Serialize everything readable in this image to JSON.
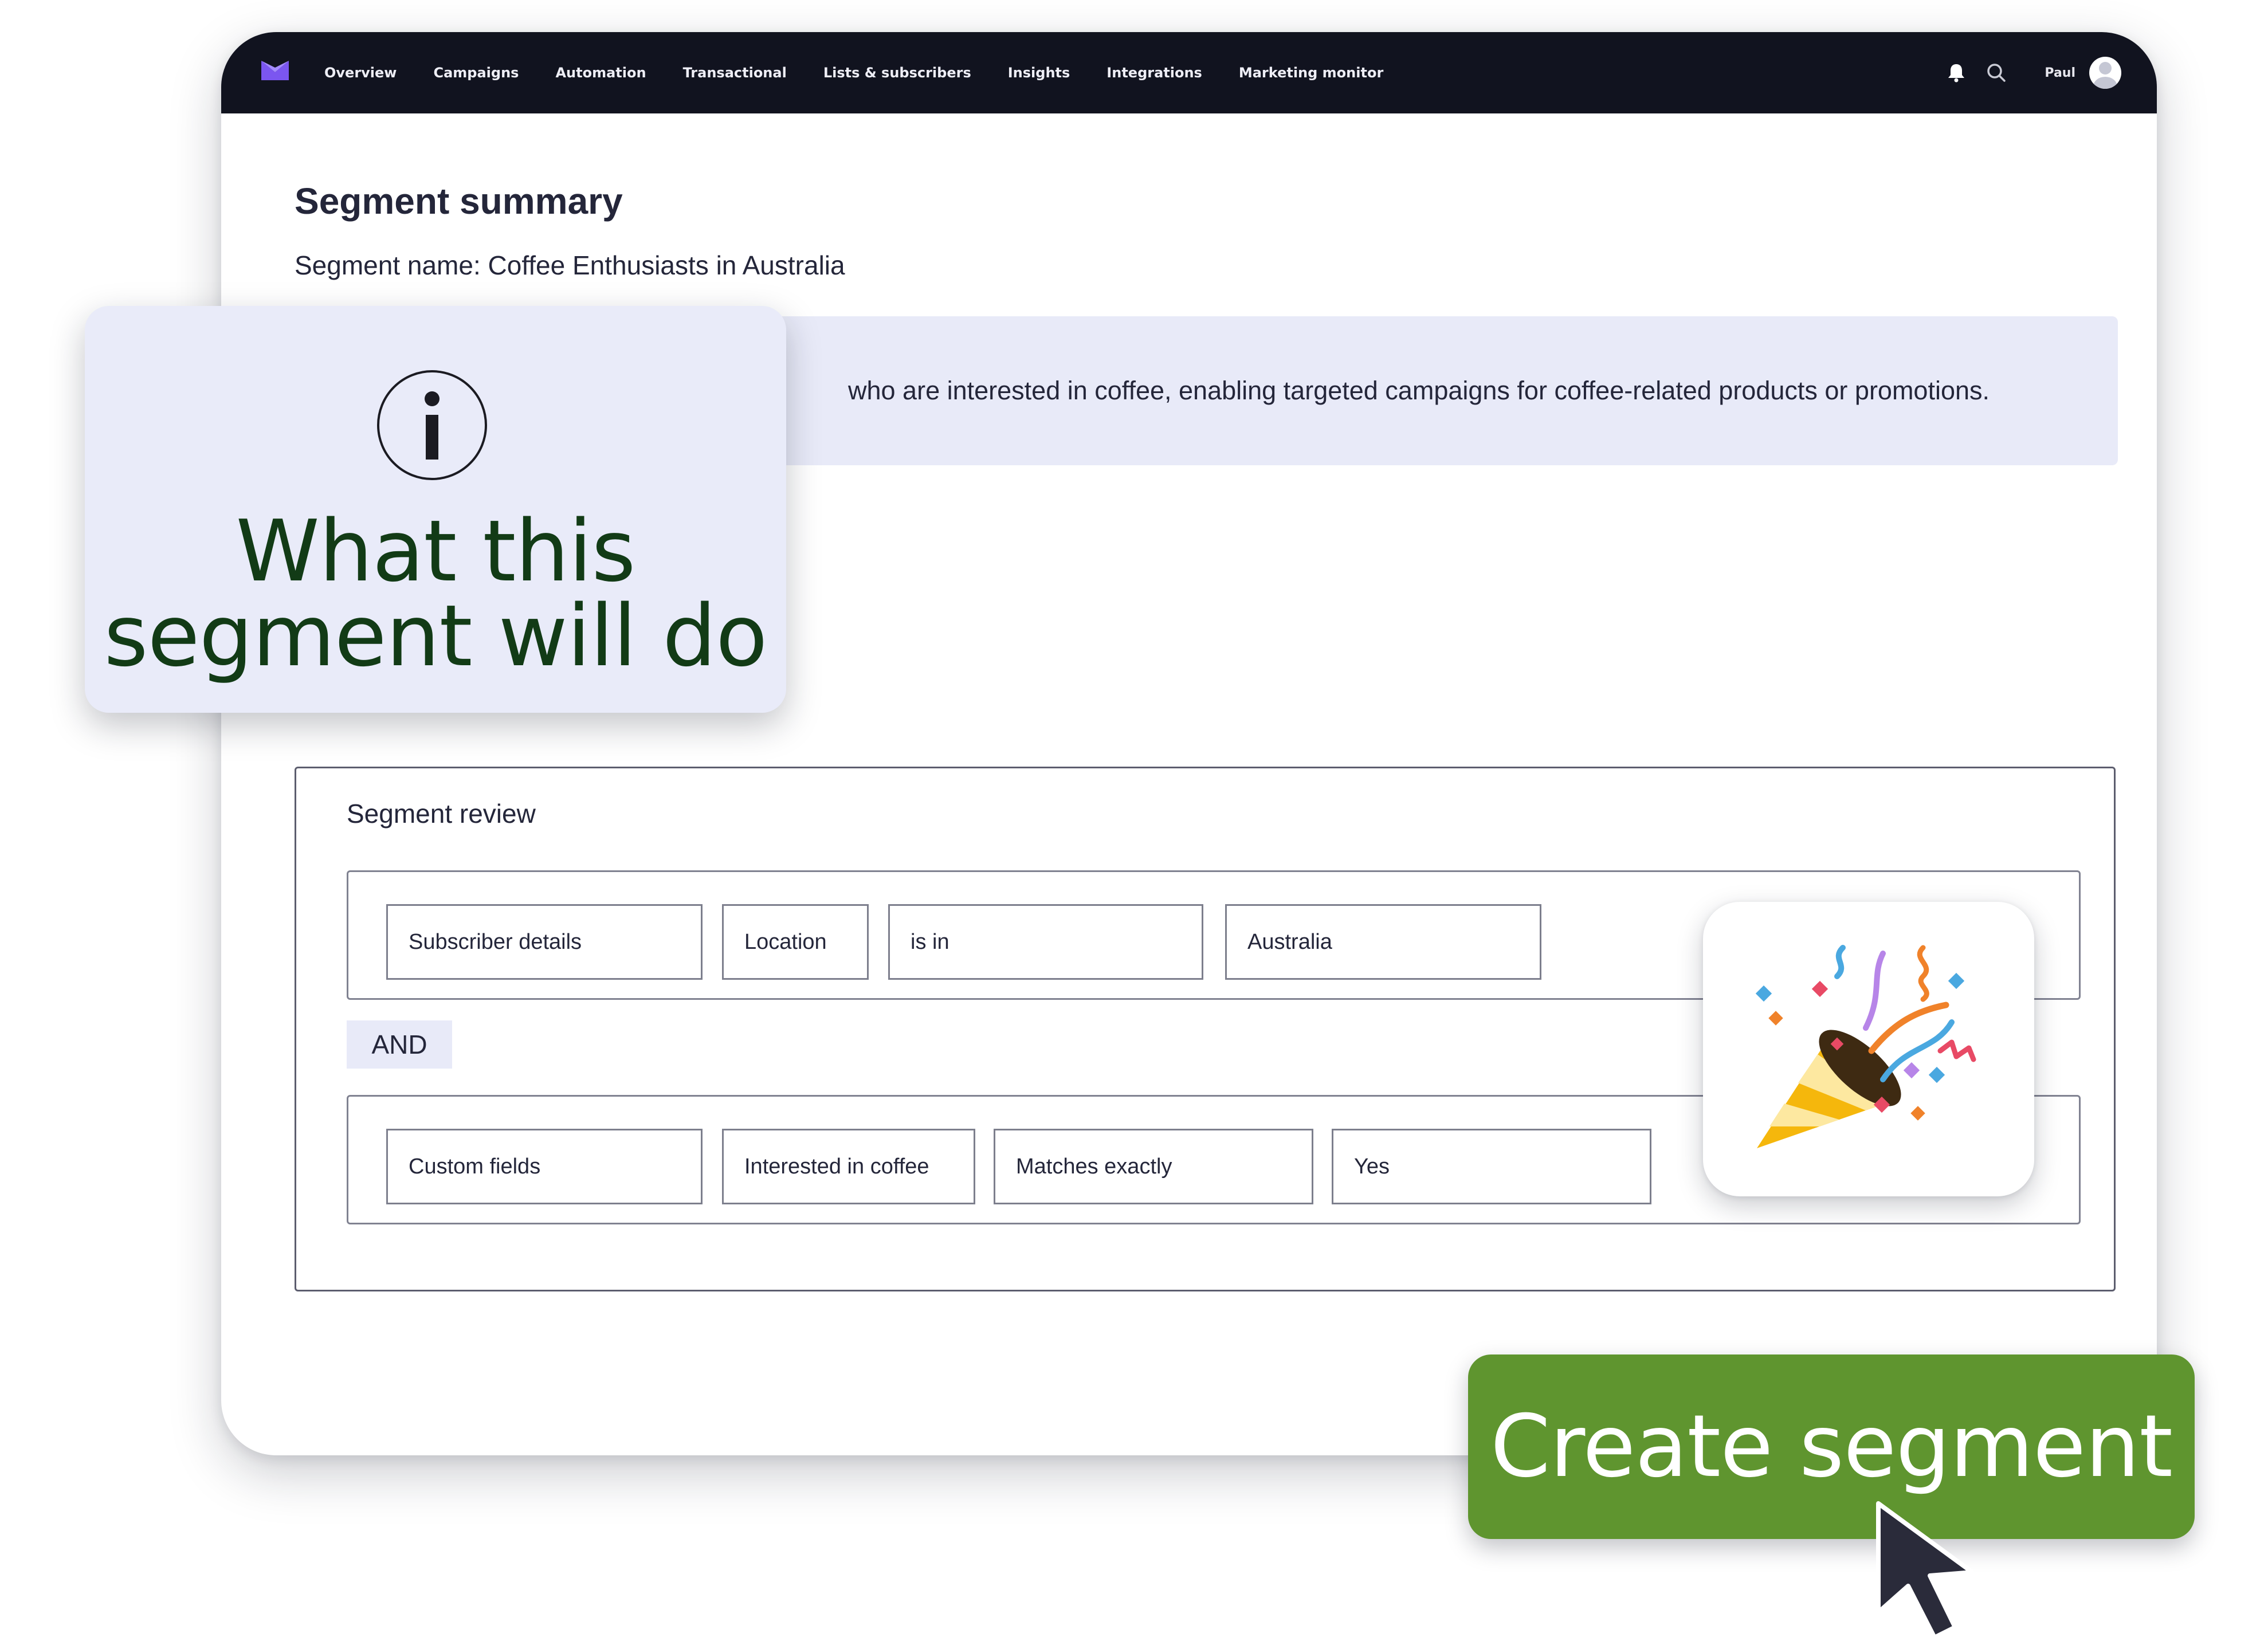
{
  "nav": {
    "items": [
      "Overview",
      "Campaigns",
      "Automation",
      "Transactional",
      "Lists & subscribers",
      "Insights",
      "Integrations",
      "Marketing monitor"
    ],
    "user_name": "Paul"
  },
  "summary": {
    "title": "Segment summary",
    "segment_name": "Segment name: Coffee Enthusiasts in Australia",
    "description_visible": "who are interested in coffee, enabling targeted campaigns for coffee-related products or promotions."
  },
  "info_card": {
    "heading_line1": "What this",
    "heading_line2": "segment will do"
  },
  "review": {
    "title": "Segment review",
    "rules": [
      [
        "Subscriber details",
        "Location",
        "is in",
        "Australia"
      ],
      [
        "Custom fields",
        "Interested in coffee",
        "Matches exactly",
        "Yes"
      ]
    ],
    "operator": "AND"
  },
  "cta": {
    "label": "Create segment"
  },
  "colors": {
    "nav_background": "#11131f",
    "brand_purple": "#7b56f0",
    "panel_tint": "#e8eaf8",
    "cta_green": "#5f952f",
    "heading_green": "#123b16"
  }
}
